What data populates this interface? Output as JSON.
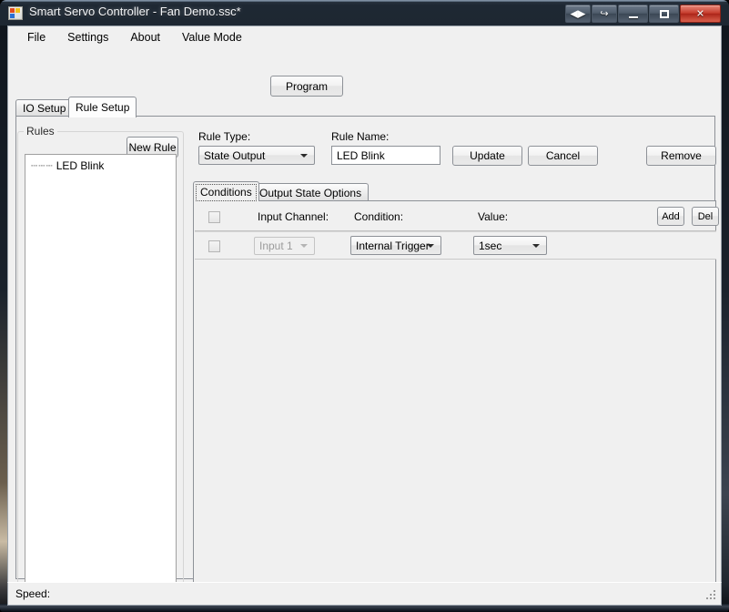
{
  "window": {
    "title": "Smart Servo Controller - Fan Demo.ssc*",
    "icon": "app-squares-icon",
    "caption_buttons": [
      {
        "name": "resize-horizontal-button",
        "glyph": "◀▶"
      },
      {
        "name": "restore-export-button",
        "glyph": "↪"
      },
      {
        "name": "minimize-button",
        "glyph": "–"
      },
      {
        "name": "maximize-button",
        "glyph": "□"
      },
      {
        "name": "close-button",
        "glyph": "✕"
      }
    ]
  },
  "menu": {
    "items": [
      {
        "label": "File"
      },
      {
        "label": "Settings"
      },
      {
        "label": "About"
      },
      {
        "label": "Value Mode"
      }
    ]
  },
  "toolbar": {
    "program_label": "Program"
  },
  "tabs": {
    "items": [
      {
        "label": "IO Setup",
        "active": false
      },
      {
        "label": "Rule Setup",
        "active": true
      }
    ]
  },
  "rules_group": {
    "title": "Rules",
    "new_rule_label": "New Rule",
    "tree_items": [
      {
        "label": "LED Blink",
        "prefix": "┄┄┄"
      }
    ]
  },
  "detail": {
    "rule_type_label": "Rule Type:",
    "rule_type_value": "State Output",
    "rule_name_label": "Rule Name:",
    "rule_name_value": "LED Blink",
    "update_label": "Update",
    "cancel_label": "Cancel",
    "remove_label": "Remove"
  },
  "inner_tabs": {
    "items": [
      {
        "label": "Conditions",
        "active": true
      },
      {
        "label": "Output State Options",
        "active": false
      }
    ]
  },
  "conditions": {
    "add_label": "Add",
    "del_label": "Del",
    "columns": [
      {
        "label": "Input Channel:"
      },
      {
        "label": "Condition:"
      },
      {
        "label": "Value:"
      }
    ],
    "rows": [
      {
        "checked": false,
        "input_channel": "Input 1",
        "input_channel_disabled": true,
        "condition": "Internal Trigger",
        "value": "1sec"
      }
    ]
  },
  "statusbar": {
    "text": "Speed:"
  },
  "colors": {
    "title_bar": "#1d2733",
    "close_button": "#c4392b",
    "client_background": "#f0f0f0",
    "field_background": "#ffffff"
  }
}
